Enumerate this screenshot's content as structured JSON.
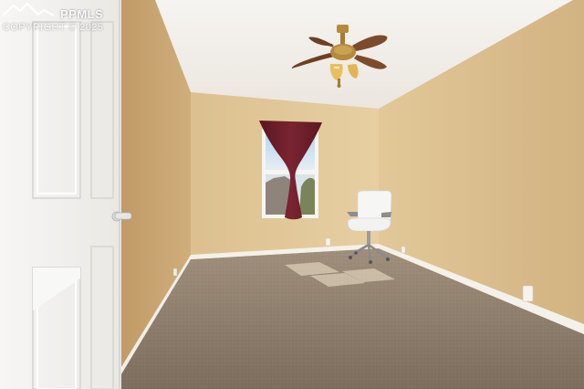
{
  "scene": {
    "subject": "empty bedroom with ceiling fan, curtained window, white office chair, carpet floor and open white door",
    "colors": {
      "wall_left": "#c9a877",
      "wall_back": "#e2c795",
      "wall_right": "#dcc090",
      "ceiling": "#f2efea",
      "carpet": "#8a7a69",
      "baseboard": "#f4f1ea",
      "door": "#f5f4f2",
      "curtain": "#6e1f2a",
      "fan_blade": "#7a4a2a",
      "fan_brass": "#b58a3a"
    }
  },
  "watermark": {
    "brand": "PPMLS",
    "copyright": "COPYRIGHT © 2025"
  }
}
